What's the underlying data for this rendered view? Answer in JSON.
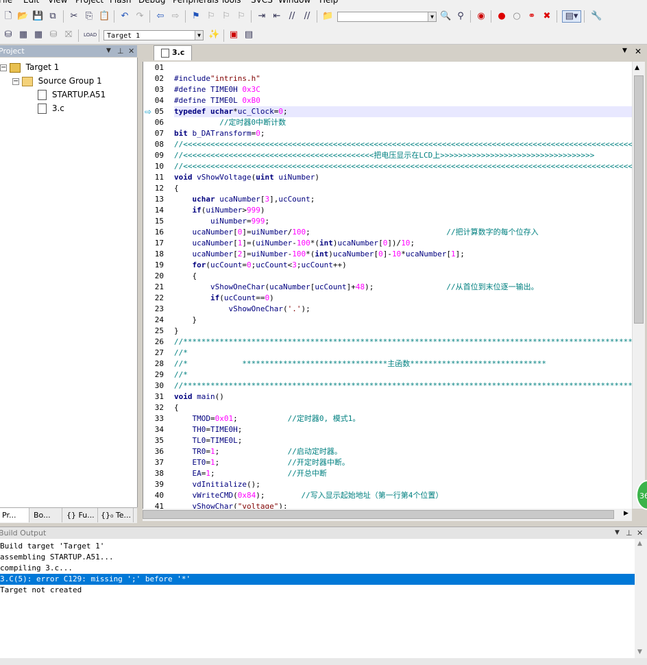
{
  "menu": [
    "File",
    "Edit",
    "View",
    "Project",
    "Flash",
    "Debug",
    "Peripherals",
    "Tools",
    "SVCS",
    "Window",
    "Help"
  ],
  "toolbar2": {
    "target_select": "Target 1"
  },
  "project_panel": {
    "title": "Project",
    "tree": [
      {
        "label": "Target 1"
      },
      {
        "label": "Source Group 1"
      },
      {
        "label": "STARTUP.A51"
      },
      {
        "label": "3.c"
      }
    ],
    "tabs": [
      "Pr...",
      "Bo...",
      "{} Fu...",
      "{}₀ Te..."
    ]
  },
  "editor": {
    "tab": "3.c",
    "current_line": 5,
    "lines": [
      "",
      "#include\"intrins.h\"",
      "#define TIME0H 0x3C",
      "#define TIME0L 0xB0",
      "typedef uchar*uc_Clock=0;",
      "          //定时器0中断计数",
      "bit b_DATransform=0;",
      "//<<<<<<<<<<<<<<<<<<<<<<<<<<<<<<<<<<<<<<<<<<<<<<<<<<<<<<<<<<<<<<<<<<<<<<<<<<<<<<<<<<<<<<<<<<<<<<<<<<<<<<<<<<<<<<<<",
      "//<<<<<<<<<<<<<<<<<<<<<<<<<<<<<<<<<<<<<<<<<<把电压显示在LCD上>>>>>>>>>>>>>>>>>>>>>>>>>>>>>>>>>>",
      "//<<<<<<<<<<<<<<<<<<<<<<<<<<<<<<<<<<<<<<<<<<<<<<<<<<<<<<<<<<<<<<<<<<<<<<<<<<<<<<<<<<<<<<<<<<<<<<<<<<<<<<<<<<<<<<<<",
      "void vShowVoltage(uint uiNumber)",
      "{",
      "    uchar ucaNumber[3],ucCount;",
      "    if(uiNumber>999)",
      "        uiNumber=999;",
      "    ucaNumber[0]=uiNumber/100;                              //把计算数字的每个位存入",
      "    ucaNumber[1]=(uiNumber-100*(int)ucaNumber[0])/10;",
      "    ucaNumber[2]=uiNumber-100*(int)ucaNumber[0]-10*ucaNumber[1];",
      "    for(ucCount=0;ucCount<3;ucCount++)",
      "    {",
      "        vShowOneChar(ucaNumber[ucCount]+48);                //从首位到末位逐一输出。",
      "        if(ucCount==0)",
      "            vShowOneChar('.');",
      "    }",
      "}",
      "//**************************************************************************************************************",
      "//*",
      "//*            ********************************主函数******************************",
      "//*",
      "//**************************************************************************************************************",
      "void main()",
      "{",
      "    TMOD=0x01;           //定时器0, 模式1。",
      "    TH0=TIME0H;",
      "    TL0=TIME0L;",
      "    TR0=1;               //启动定时器。",
      "    ET0=1;               //开定时器中断。",
      "    EA=1;                //开总中断",
      "    vdInitialize();",
      "    vWriteCMD(0x84);        //写入显示起始地址（第一行第4个位置）",
      "    vShowChar(\"voltage\");"
    ]
  },
  "build_output": {
    "title": "Build Output",
    "lines": [
      "Build target 'Target 1'",
      "assembling STARTUP.A51...",
      "compiling 3.c...",
      "3.C(5): error C129: missing ';' before '*'",
      "Target not created"
    ],
    "selected_line": 4
  },
  "badge": "36",
  "colors": {
    "keyword": "#00007f",
    "comment": "#008080",
    "number": "#ff00ff",
    "string": "#800000",
    "selection": "#0078d7",
    "current_line": "#e8e8ff"
  }
}
